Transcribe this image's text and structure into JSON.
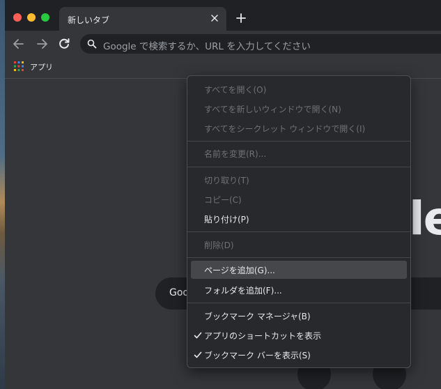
{
  "tab": {
    "title": "新しいタブ"
  },
  "omnibox": {
    "placeholder": "Google で検索するか、URL を入力してください"
  },
  "bookmarks_bar": {
    "apps_label": "アプリ"
  },
  "page": {
    "search_fragment": "Goo"
  },
  "context_menu": {
    "open_all": "すべてを開く(O)",
    "open_all_new_window": "すべてを新しいウィンドウで開く(N)",
    "open_all_incognito": "すべてをシークレット ウィンドウで開く(I)",
    "rename": "名前を変更(R)...",
    "cut": "切り取り(T)",
    "copy": "コピー(C)",
    "paste": "貼り付け(P)",
    "delete": "削除(D)",
    "add_page": "ページを追加(G)...",
    "add_folder": "フォルダを追加(F)...",
    "bookmark_manager": "ブックマーク マネージャ(B)",
    "show_apps_shortcut": "アプリのショートカットを表示",
    "show_bookmarks_bar": "ブックマーク バーを表示(S)"
  },
  "colors": {
    "frame": "#202124",
    "toolbar": "#35363a",
    "menu_bg": "#28292c",
    "menu_highlight": "#45474b"
  }
}
